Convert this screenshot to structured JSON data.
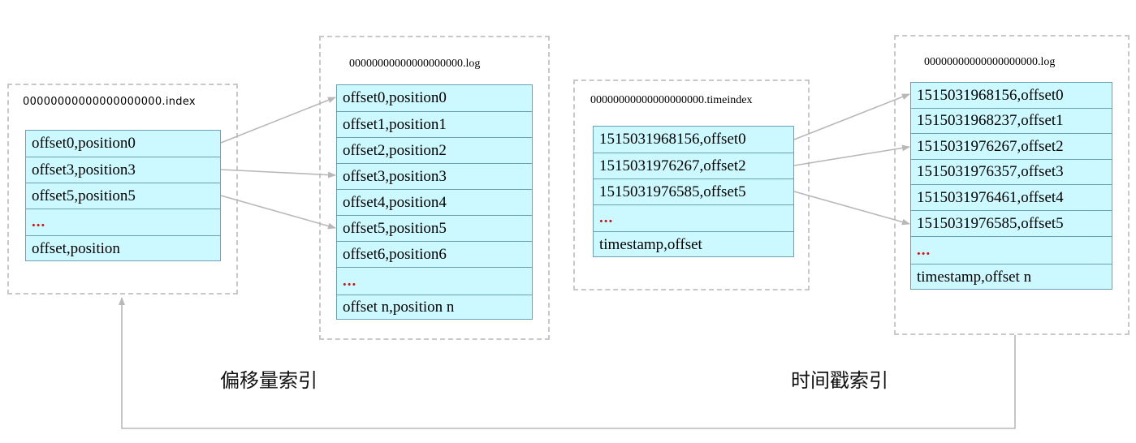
{
  "offset_index": {
    "filename": "00000000000000000000.index",
    "rows": [
      "offset0,position0",
      "offset3,position3",
      "offset5,position5",
      "...",
      "offset,position"
    ]
  },
  "offset_log": {
    "filename": "00000000000000000000.log",
    "rows": [
      "offset0,position0",
      "offset1,position1",
      "offset2,position2",
      "offset3,position3",
      "offset4,position4",
      "offset5,position5",
      "offset6,position6",
      "...",
      "offset n,position n"
    ]
  },
  "time_index": {
    "filename": "00000000000000000000.timeindex",
    "rows": [
      "1515031968156,offset0",
      "1515031976267,offset2",
      "1515031976585,offset5",
      "...",
      "timestamp,offset"
    ]
  },
  "time_log": {
    "filename": "00000000000000000000.log",
    "rows": [
      "1515031968156,offset0",
      "1515031968237,offset1",
      "1515031976267,offset2",
      "1515031976357,offset3",
      "1515031976461,offset4",
      "1515031976585,offset5",
      "...",
      "timestamp,offset n"
    ]
  },
  "captions": {
    "offset_index": "偏移量索引",
    "timestamp_index": "时间戳索引"
  },
  "colors": {
    "cell_fill": "#ccf9ff",
    "cell_border": "#6aa0b8",
    "ellipsis": "#d01010",
    "arrow": "#b8b8b8",
    "panel_border": "#c8c8c8"
  }
}
